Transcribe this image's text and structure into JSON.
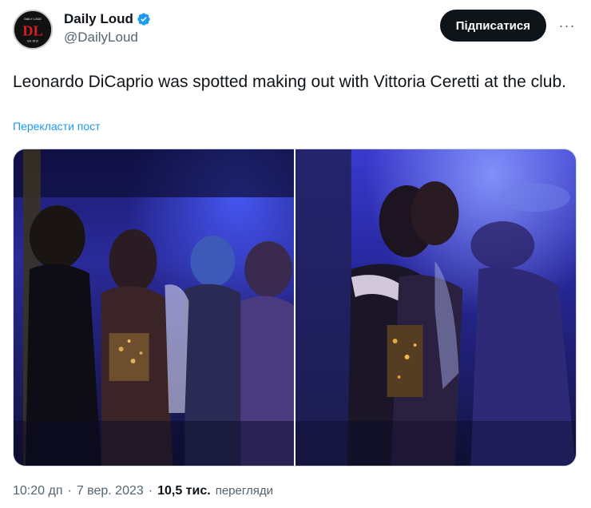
{
  "author": {
    "display_name": "Daily Loud",
    "handle": "@DailyLoud",
    "verified": true,
    "avatar_text": "DL",
    "avatar_top_text": "DAILY LOUD",
    "avatar_bottom_text": "Est. 2013"
  },
  "actions": {
    "follow_label": "Підписатися",
    "more_label": "···"
  },
  "tweet": {
    "text": "Leonardo DiCaprio was spotted making out with Vittoria Ceretti at the club.",
    "translate_label": "Перекласти пост"
  },
  "media": {
    "photo_count": 2
  },
  "meta": {
    "time": "10:20 дп",
    "separator": "·",
    "date": "7 вер. 2023",
    "views_count": "10,5 тис.",
    "views_label": "перегляди"
  },
  "colors": {
    "accent": "#1d9bf0",
    "text": "#0f1419",
    "secondary": "#536471",
    "button_bg": "#0f1419",
    "avatar_red": "#d32027"
  }
}
